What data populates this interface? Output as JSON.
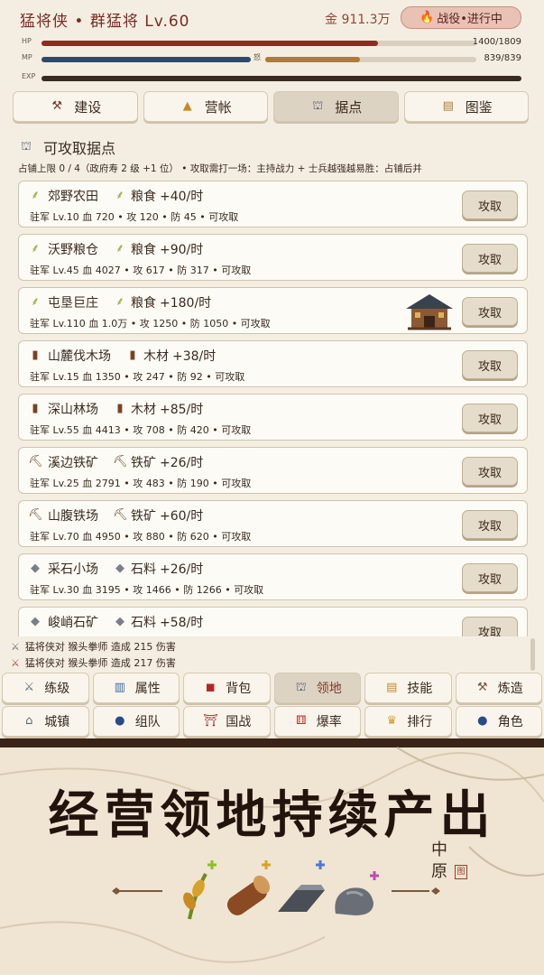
{
  "header": {
    "title": "猛将侠 • 群猛将 Lv.60",
    "gold": "金 911.3万",
    "battle_btn": "战役•进行中",
    "hp_label": "HP",
    "hp_value": "1400/1809",
    "hp_fraction": 0.774,
    "mp_label": "MP",
    "mp_value": "839/839",
    "mp_fraction": 1.0,
    "mp_mark": "怒",
    "exp_label": "EXP",
    "exp_fraction": 1.0
  },
  "tabs": [
    {
      "label": "建设",
      "icon": "crane-icon",
      "active": false
    },
    {
      "label": "营帐",
      "icon": "tent-icon",
      "active": false
    },
    {
      "label": "据点",
      "icon": "castle-icon",
      "active": true
    },
    {
      "label": "图鉴",
      "icon": "scroll-icon",
      "active": false
    }
  ],
  "section": {
    "title": "可攻取据点",
    "rule": "占铺上限 0 / 4（政府寿 2 级 +1 位） • 攻取需打一场：主持战力 + 士兵越强越易胜：占铺后并"
  },
  "strongholds": [
    {
      "name": "郊野农田",
      "res_icon": "grain",
      "res": "粮食",
      "prod": "+40/时",
      "stats": "驻军 Lv.10  血 720  •  攻 120  •  防 45  •  可攻取",
      "btn": "攻取"
    },
    {
      "name": "沃野粮仓",
      "res_icon": "grain",
      "res": "粮食",
      "prod": "+90/时",
      "stats": "驻军 Lv.45  血 4027  •  攻 617  •  防 317  •  可攻取",
      "btn": "攻取"
    },
    {
      "name": "屯垦巨庄",
      "res_icon": "grain",
      "res": "粮食",
      "prod": "+180/时",
      "stats": "驻军 Lv.110  血 1.0万  •  攻 1250  •  防 1050  •  可攻取",
      "btn": "攻取",
      "building": true
    },
    {
      "name": "山麓伐木场",
      "res_icon": "wood",
      "res": "木材",
      "prod": "+38/时",
      "stats": "驻军 Lv.15  血 1350  •  攻 247  •  防 92  •  可攻取",
      "btn": "攻取"
    },
    {
      "name": "深山林场",
      "res_icon": "wood",
      "res": "木材",
      "prod": "+85/时",
      "stats": "驻军 Lv.55  血 4413  •  攻 708  •  防 420  •  可攻取",
      "btn": "攻取"
    },
    {
      "name": "溪边铁矿",
      "res_icon": "iron",
      "res": "铁矿",
      "prod": "+26/时",
      "stats": "驻军 Lv.25  血 2791  •  攻 483  •  防 190  •  可攻取",
      "btn": "攻取"
    },
    {
      "name": "山腹铁场",
      "res_icon": "iron",
      "res": "铁矿",
      "prod": "+60/时",
      "stats": "驻军 Lv.70  血 4950  •  攻 880  •  防 620  •  可攻取",
      "btn": "攻取"
    },
    {
      "name": "采石小场",
      "res_icon": "stone",
      "res": "石料",
      "prod": "+26/时",
      "stats": "驻军 Lv.30  血 3195  •  攻 1466  •  防 1266  •  可攻取",
      "btn": "攻取"
    },
    {
      "name": "峻峭石矿",
      "res_icon": "stone",
      "res": "石料",
      "prod": "+58/时",
      "stats": "",
      "btn": "攻取"
    }
  ],
  "log": [
    "猛将侠对 猴头拳师 造成 215 伤害",
    "猛将侠对 猴头拳师 造成 217 伤害"
  ],
  "nav_row1": [
    {
      "label": "练级",
      "icon": "swords-icon",
      "active": false
    },
    {
      "label": "属性",
      "icon": "chart-icon",
      "active": false
    },
    {
      "label": "背包",
      "icon": "bag-icon",
      "active": false
    },
    {
      "label": "领地",
      "icon": "castle-icon",
      "active": true
    },
    {
      "label": "技能",
      "icon": "book-icon",
      "active": false
    },
    {
      "label": "炼造",
      "icon": "hammer-icon",
      "active": false
    }
  ],
  "nav_row2": [
    {
      "label": "城镇",
      "icon": "temple-icon",
      "active": false
    },
    {
      "label": "组队",
      "icon": "team-icon",
      "active": false
    },
    {
      "label": "国战",
      "icon": "gate-icon",
      "active": false
    },
    {
      "label": "爆率",
      "icon": "dice-icon",
      "active": false
    },
    {
      "label": "排行",
      "icon": "trophy-icon",
      "active": false
    },
    {
      "label": "角色",
      "icon": "person-icon",
      "active": false
    }
  ],
  "promo": {
    "headline": "经营领地持续产出",
    "map_label": "中原",
    "seal": "图"
  },
  "colors": {
    "hp": "#8e2b22",
    "mp": "#2e4a68",
    "mp_rage": "#b07a3a",
    "exp": "#3a2a22"
  }
}
